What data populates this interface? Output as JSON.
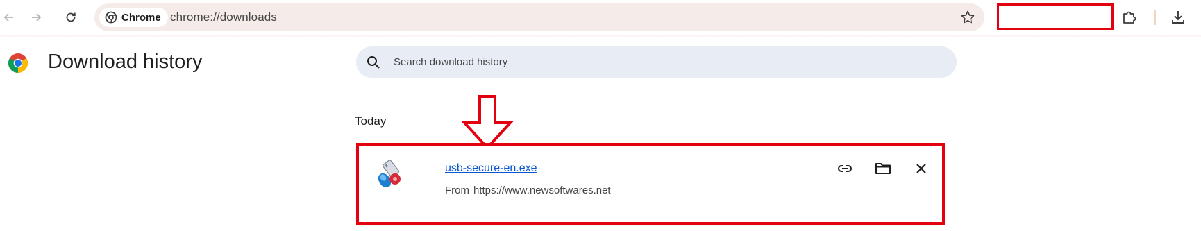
{
  "browser": {
    "chip_label": "Chrome",
    "url": "chrome://downloads"
  },
  "page": {
    "title": "Download history",
    "search_placeholder": "Search download history",
    "section": "Today"
  },
  "download": {
    "file_name": "usb-secure-en.exe",
    "from_label": "From",
    "source_url": "https://www.newsoftwares.net"
  },
  "colors": {
    "highlight": "#e3000f",
    "link": "#0b57d0",
    "omnibox": "#f5ebe8",
    "search_bg": "#e8ecf5"
  },
  "icons": {
    "back": "arrow-left-icon",
    "forward": "arrow-right-icon",
    "reload": "reload-icon",
    "bookmark": "star-icon",
    "extensions": "puzzle-icon",
    "downloads": "download-icon",
    "copy_link": "link-icon",
    "show_in_folder": "folder-icon",
    "remove": "close-icon"
  }
}
